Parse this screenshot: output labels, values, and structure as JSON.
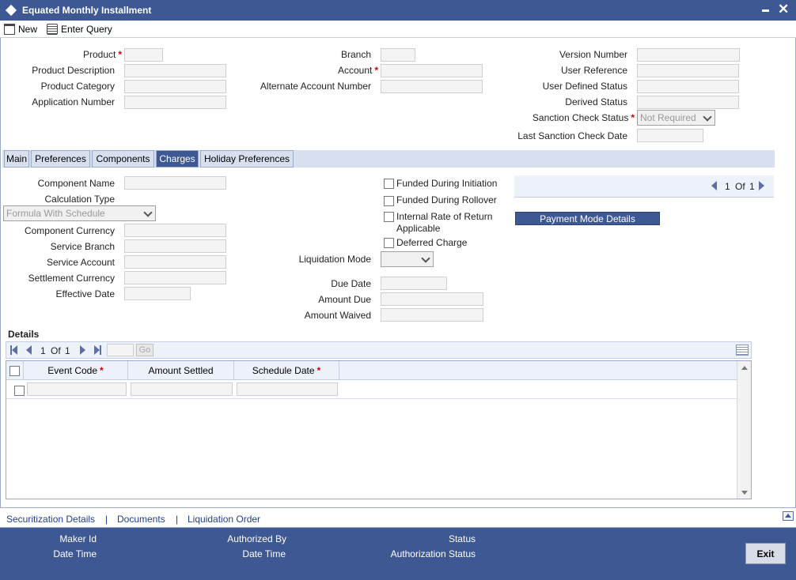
{
  "window": {
    "title": "Equated Monthly Installment"
  },
  "toolbar": {
    "new_label": "New",
    "enter_query_label": "Enter Query"
  },
  "header": {
    "product": "Product",
    "product_description": "Product Description",
    "product_category": "Product Category",
    "application_number": "Application Number",
    "branch": "Branch",
    "account": "Account",
    "alternate_account_number": "Alternate Account Number",
    "version_number": "Version Number",
    "user_reference": "User Reference",
    "user_defined_status": "User Defined Status",
    "derived_status": "Derived Status",
    "sanction_check_status": "Sanction Check Status",
    "sanction_check_status_value": "Not Required",
    "last_sanction_check_date": "Last Sanction Check Date"
  },
  "tabs": [
    "Main",
    "Preferences",
    "Components",
    "Charges",
    "Holiday Preferences"
  ],
  "charges": {
    "component_name": "Component Name",
    "calculation_type": "Calculation Type",
    "calculation_type_value": "Formula With Schedule",
    "component_currency": "Component Currency",
    "service_branch": "Service Branch",
    "service_account": "Service Account",
    "settlement_currency": "Settlement Currency",
    "effective_date": "Effective Date",
    "funded_during_initiation": "Funded During Initiation",
    "funded_during_rollover": "Funded During Rollover",
    "internal_rate_of_return": "Internal Rate of Return",
    "applicable": "Applicable",
    "deferred_charge": "Deferred Charge",
    "liquidation_mode": "Liquidation Mode",
    "due_date": "Due Date",
    "amount_due": "Amount Due",
    "amount_waived": "Amount Waived",
    "pager_current": "1",
    "pager_of": "Of",
    "pager_total": "1",
    "payment_mode_details": "Payment Mode Details"
  },
  "details": {
    "title": "Details",
    "pager_current": "1",
    "pager_of": "Of",
    "pager_total": "1",
    "go_label": "Go",
    "columns": [
      "Event Code",
      "Amount Settled",
      "Schedule Date"
    ]
  },
  "footer_links": [
    "Securitization Details",
    "Documents",
    "Liquidation Order"
  ],
  "footer_separator": "|",
  "footer": {
    "maker_id": "Maker Id",
    "date_time_1": "Date Time",
    "authorized_by": "Authorized By",
    "date_time_2": "Date Time",
    "status": "Status",
    "authorization_status": "Authorization Status",
    "exit_label": "Exit"
  },
  "required_mark": "*",
  "colors": {
    "brand": "#3e5893",
    "required": "#cc0000",
    "tab_bg": "#d8e0f0"
  }
}
